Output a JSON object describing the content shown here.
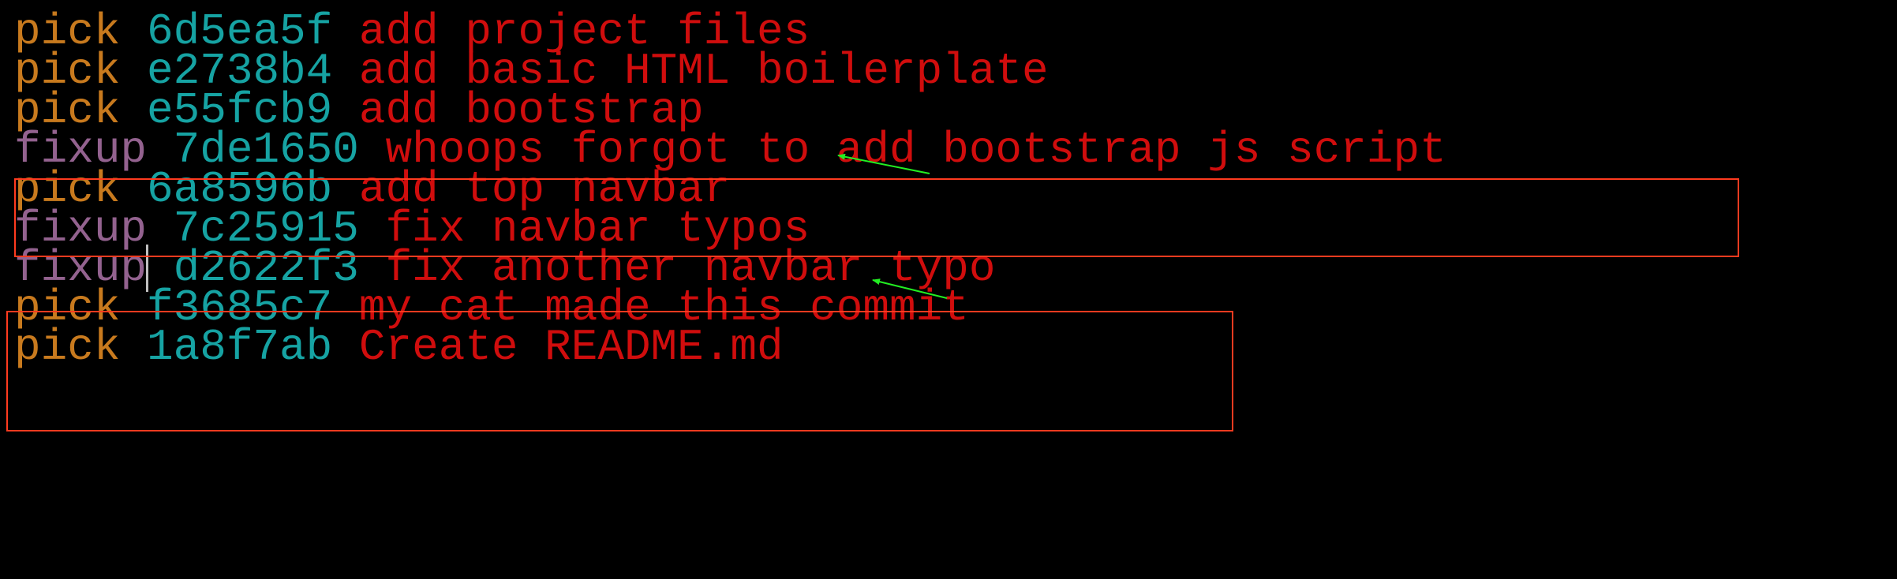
{
  "terminal": {
    "lines": [
      {
        "cmd": "pick",
        "hash": "6d5ea5f",
        "msg": "add project files"
      },
      {
        "cmd": "pick",
        "hash": "e2738b4",
        "msg": "add basic HTML boilerplate"
      },
      {
        "cmd": "pick",
        "hash": "e55fcb9",
        "msg": "add bootstrap"
      },
      {
        "cmd": "fixup",
        "hash": "7de1650",
        "msg": "whoops forgot to add bootstrap js script"
      },
      {
        "cmd": "pick",
        "hash": "6a8596b",
        "msg": "add top navbar"
      },
      {
        "cmd": "fixup",
        "hash": "7c25915",
        "msg": "fix navbar typos"
      },
      {
        "cmd": "fixup",
        "hash": "d2622f3",
        "msg": "fix another navbar typo"
      },
      {
        "cmd": "pick",
        "hash": "f3685c7",
        "msg": "my cat made this commit"
      },
      {
        "cmd": "pick",
        "hash": "1a8f7ab",
        "msg": "Create README.md"
      }
    ]
  },
  "colors": {
    "background": "#000000",
    "pick": "#c87a1e",
    "fixup": "#93628f",
    "hash": "#16a3a3",
    "message": "#d00d0d",
    "highlight_box": "#ff3b1f",
    "arrow": "#22ee22"
  },
  "annotations": {
    "boxes": [
      "fixup-7de1650",
      "fixup-7c25915-d2622f3"
    ],
    "arrows": [
      "arrow-to-add-bootstrap",
      "arrow-to-add-top-navbar"
    ]
  }
}
